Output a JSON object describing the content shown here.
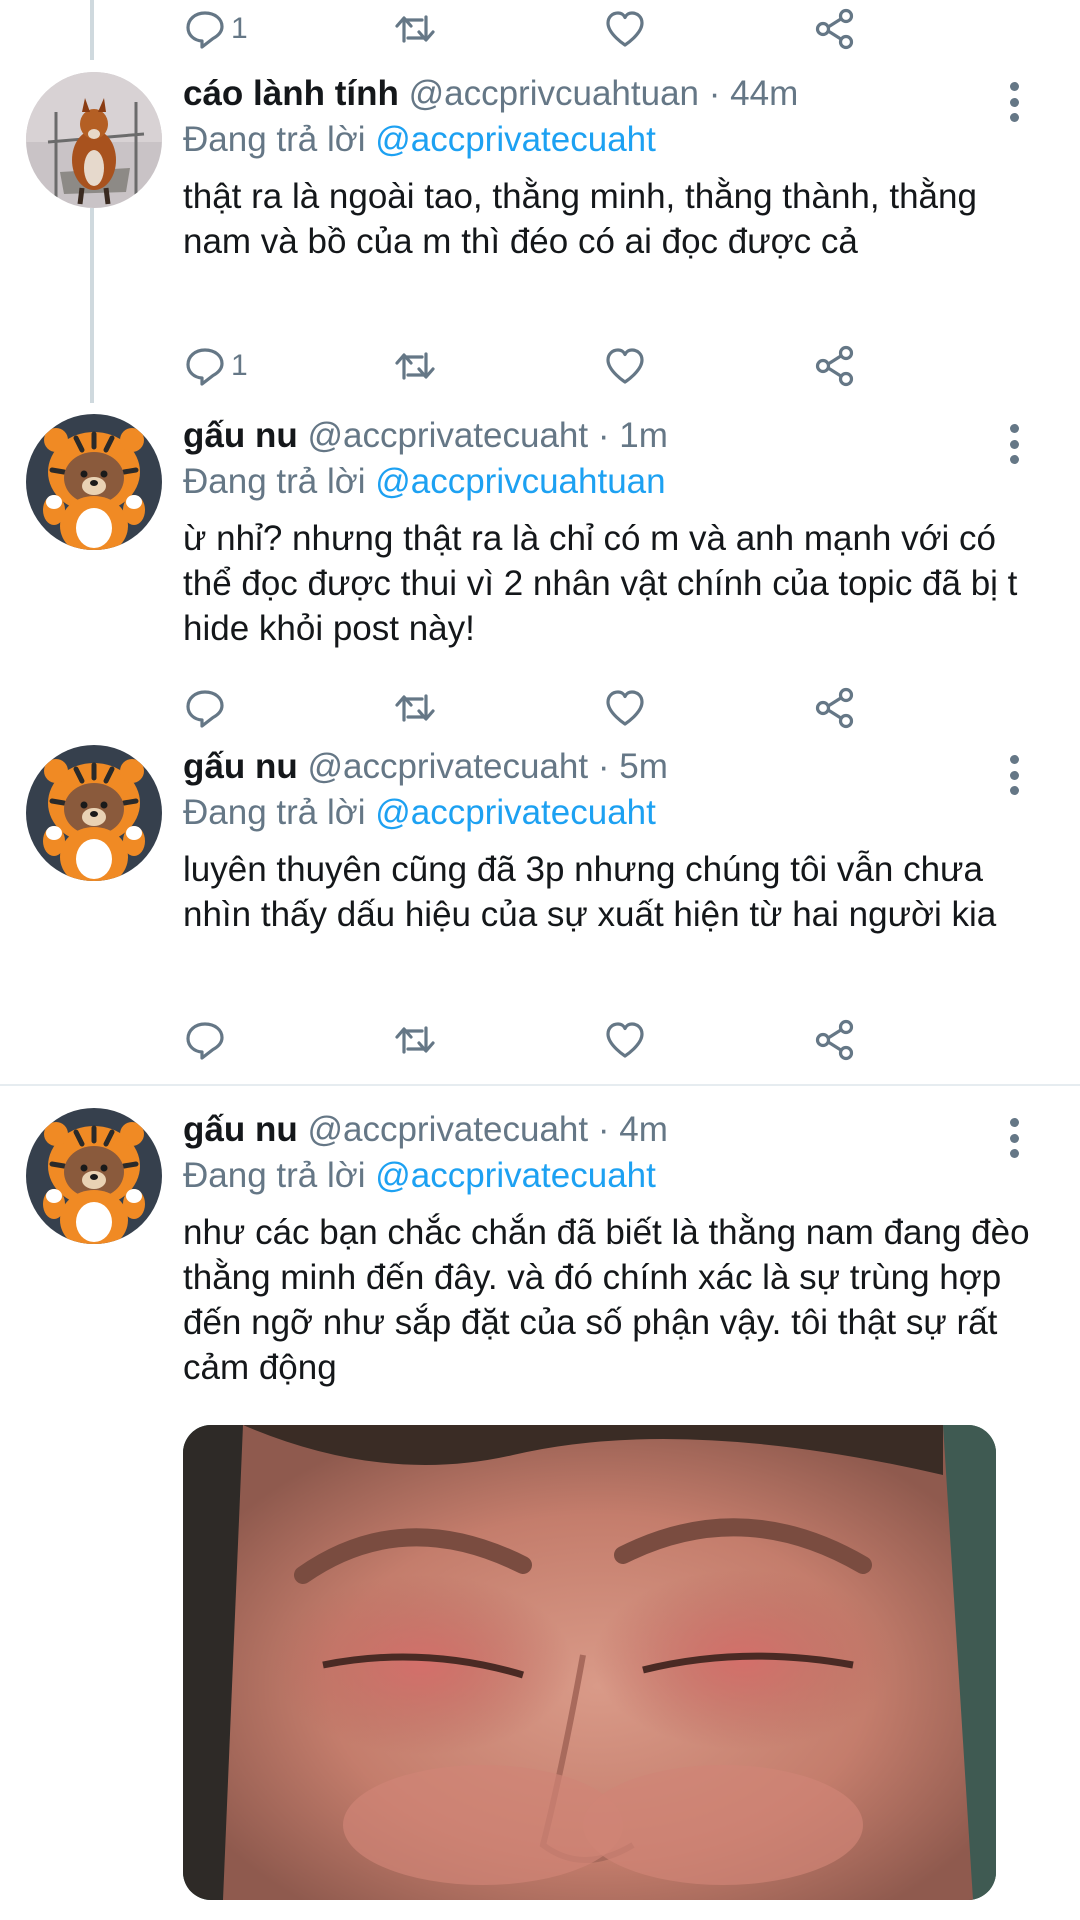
{
  "top_actions": {
    "reply_count": "1"
  },
  "tweets": [
    {
      "avatar": "fox-avatar",
      "name": "cáo lành tính",
      "handle": "@accprivcuahtuan",
      "time": "44m",
      "replying_label": "Đang trả lời",
      "replying_to": "@accprivatecuaht",
      "text": "thật ra là ngoài tao, thằng minh, thằng thành, thằng nam và bồ của m thì đéo có ai đọc được cả",
      "reply_count": "1"
    },
    {
      "avatar": "tiger-bear-avatar",
      "name": "gấu nu",
      "handle": "@accprivatecuaht",
      "time": "1m",
      "replying_label": "Đang trả lời",
      "replying_to": "@accprivcuahtuan",
      "text": "ừ nhỉ? nhưng thật ra là chỉ có m và anh mạnh với có thể đọc được thui vì 2 nhân vật chính của topic đã bị t hide khỏi post này!",
      "reply_count": ""
    },
    {
      "avatar": "tiger-bear-avatar",
      "name": "gấu nu",
      "handle": "@accprivatecuaht",
      "time": "5m",
      "replying_label": "Đang trả lời",
      "replying_to": "@accprivatecuaht",
      "text": "luyên thuyên cũng đã 3p nhưng chúng tôi vẫn chưa nhìn thấy dấu hiệu của sự xuất hiện từ hai người kia",
      "reply_count": ""
    },
    {
      "avatar": "tiger-bear-avatar",
      "name": "gấu nu",
      "handle": "@accprivatecuaht",
      "time": "4m",
      "replying_label": "Đang trả lời",
      "replying_to": "@accprivatecuaht",
      "text": "như các bạn chắc chắn đã biết là thằng nam đang đèo thằng minh đến đây. và đó chính xác là sự trùng hợp đến ngỡ như sắp đặt của số phận vậy. tôi thật sự rất cảm động",
      "media": "photo of a face with swollen eyes"
    }
  ],
  "colors": {
    "accent": "#1da1f2",
    "secondary_text": "#657786",
    "primary_text": "#14171a",
    "divider": "#e6ecf0",
    "thread_line": "#cfd9de"
  },
  "icons": [
    "reply-icon",
    "retweet-icon",
    "like-icon",
    "share-icon",
    "more-options-icon"
  ]
}
